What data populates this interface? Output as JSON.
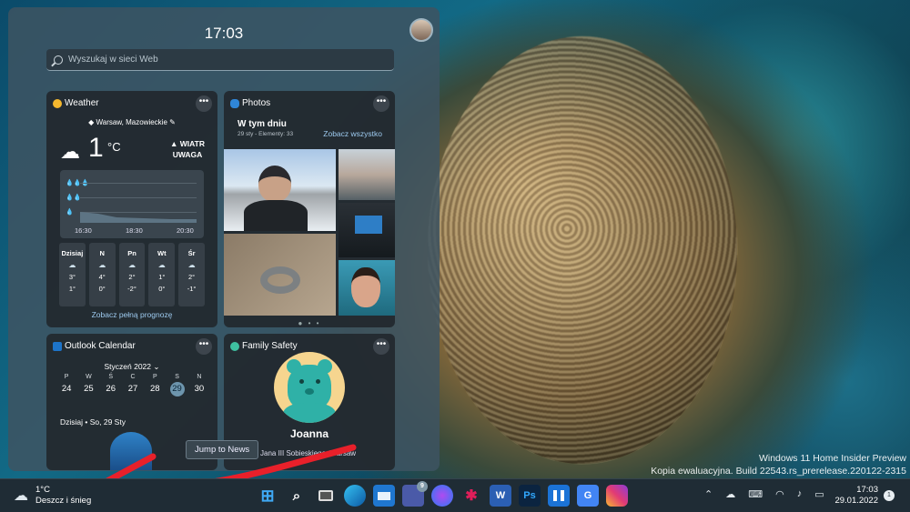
{
  "widgets": {
    "clock": "17:03",
    "search": {
      "placeholder": "Wyszukaj w sieci Web"
    },
    "weather": {
      "title": "Weather",
      "location": "Warsaw, Mazowieckie",
      "temperature": "1",
      "unit": "°C",
      "alert_line1": "▲ WIATR",
      "alert_line2": "UWAGA",
      "times": [
        "16:30",
        "18:30",
        "20:30"
      ],
      "forecast": [
        {
          "day": "Dzisiaj",
          "high": "3°",
          "low": "1°"
        },
        {
          "day": "N",
          "high": "4°",
          "low": "0°"
        },
        {
          "day": "Pn",
          "high": "2°",
          "low": "-2°"
        },
        {
          "day": "Wt",
          "high": "1°",
          "low": "0°"
        },
        {
          "day": "Śr",
          "high": "2°",
          "low": "-1°"
        }
      ],
      "link": "Zobacz pełną prognozę"
    },
    "photos": {
      "title": "Photos",
      "heading": "W tym dniu",
      "subtitle": "29 sty - Elementy: 33",
      "link": "Zobacz wszystko"
    },
    "outlook": {
      "title": "Outlook Calendar",
      "month": "Styczeń 2022",
      "weekdays": [
        "P",
        "W",
        "Ś",
        "C",
        "P",
        "S",
        "N"
      ],
      "dates": [
        "24",
        "25",
        "26",
        "27",
        "28",
        "29",
        "30"
      ],
      "agenda": "Dzisiaj • So, 29 Sty"
    },
    "family": {
      "title": "Family Safety",
      "name": "Joanna",
      "subtitle": "Jana III Sobieskiego, Warsaw"
    }
  },
  "tooltip": "Jump to News",
  "watermark": {
    "line1": "Windows 11 Home Insider Preview",
    "line2": "Kopia ewaluacyjna. Build 22543.rs_prerelease.220122-2315"
  },
  "taskbar": {
    "weather_temp": "1°C",
    "weather_desc": "Deszcz i śnieg",
    "time": "17:03",
    "date": "29.01.2022",
    "notifications": "1",
    "teams_badge": "9"
  },
  "colors": {
    "accent_link": "#9ecbf0",
    "annotation_arrow": "#e8202a",
    "taskbar": "#1f2c35"
  }
}
